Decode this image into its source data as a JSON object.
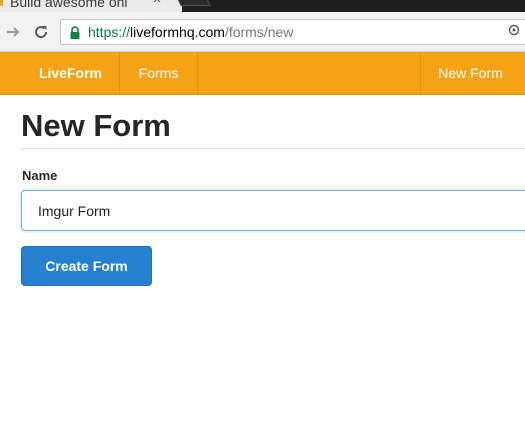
{
  "browser": {
    "tab_title": "Build awesome onl",
    "tab_close_glyph": "×",
    "url_scheme": "https://",
    "url_host": "liveformhq.com",
    "url_path": "/forms/new"
  },
  "navbar": {
    "brand": "LiveForm",
    "forms_link": "Forms",
    "new_form_link": "New Form",
    "color": "#f5a315"
  },
  "page": {
    "title": "New Form",
    "name_label": "Name",
    "name_value": "Imgur Form",
    "submit_label": "Create Form",
    "submit_color": "#2581d0"
  }
}
